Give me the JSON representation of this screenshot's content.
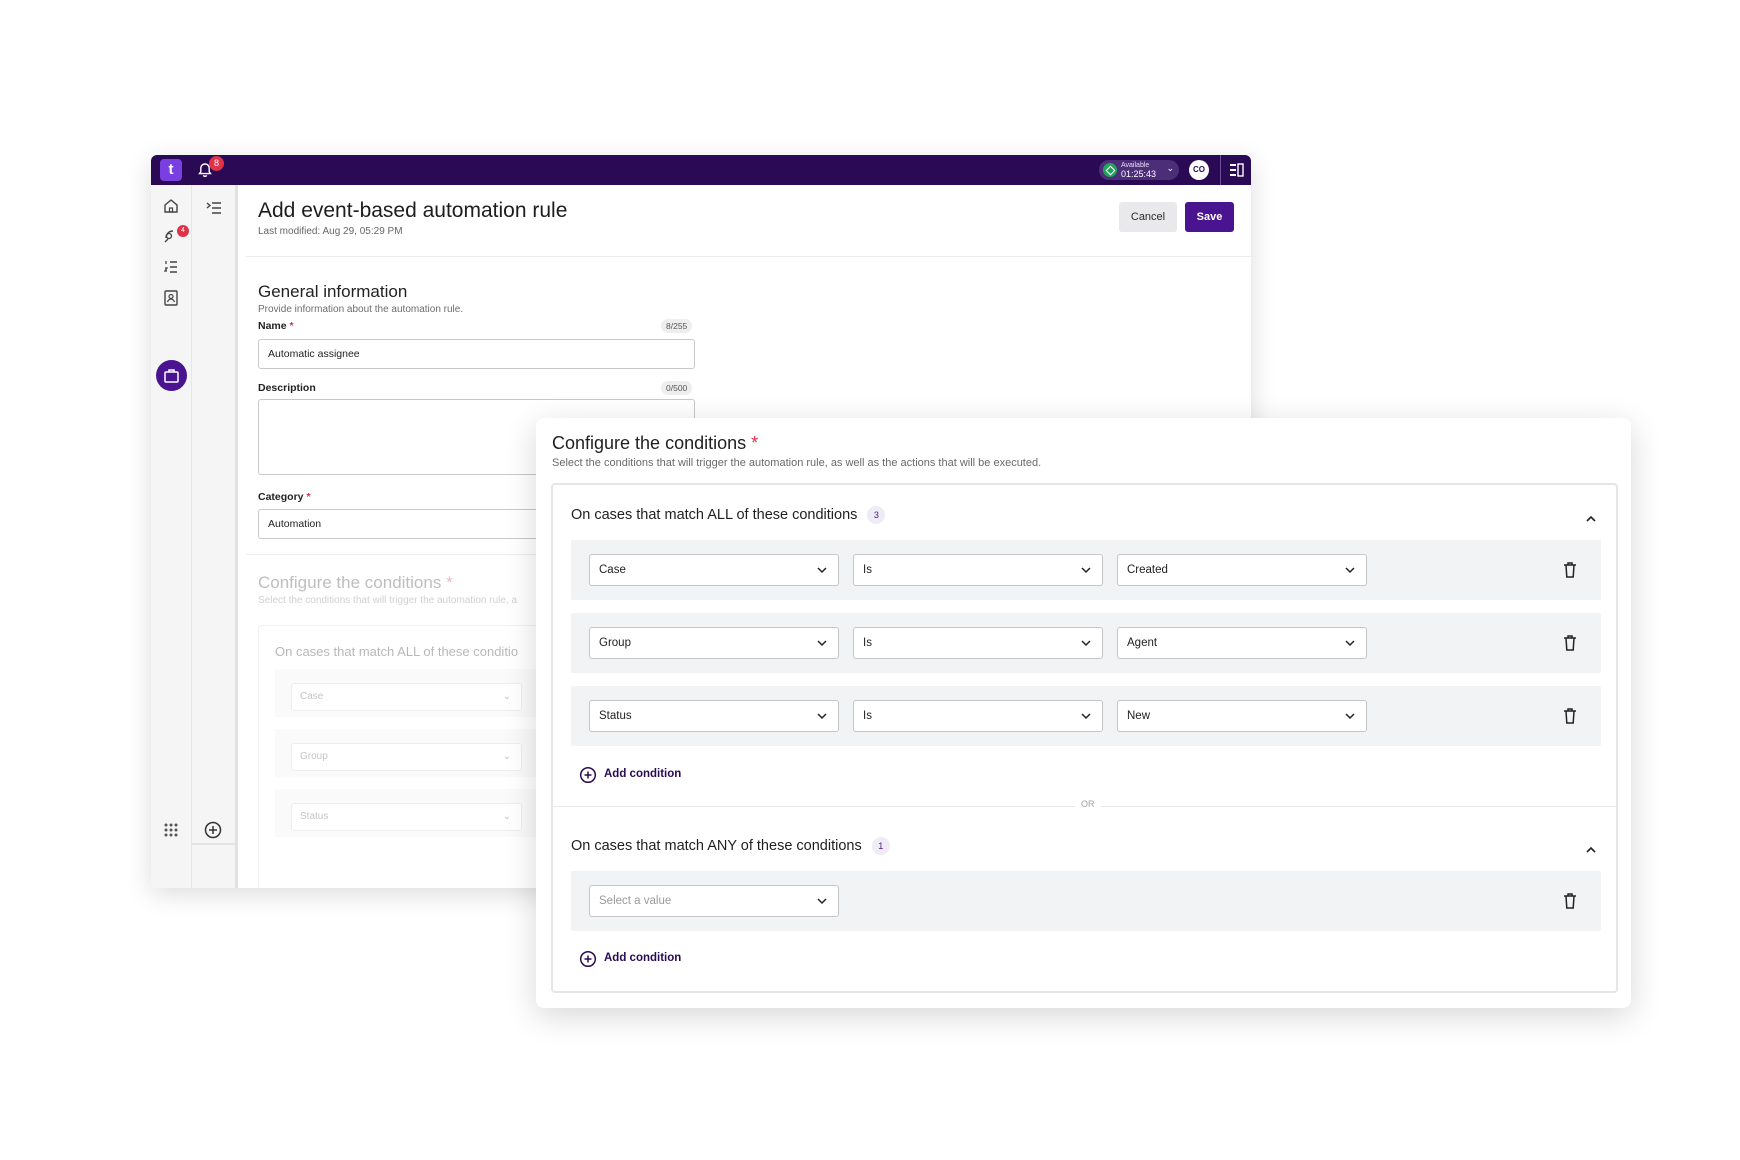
{
  "app": {
    "logo_glyph": "t",
    "notification_count": "8",
    "status": {
      "label": "Available",
      "time": "01:25:43",
      "color": "#1fa55a"
    },
    "avatar_initials": "CO",
    "rail_badge": "4",
    "brand_color": "#4a1491",
    "topbar_color": "#2a0a55"
  },
  "header": {
    "title": "Add event-based automation rule",
    "last_modified": "Last modified: Aug 29, 05:29 PM",
    "cancel_label": "Cancel",
    "save_label": "Save"
  },
  "general": {
    "title": "General information",
    "subtitle": "Provide information about the automation rule.",
    "name_label": "Name",
    "name_counter": "8/255",
    "name_value": "Automatic assignee",
    "description_label": "Description",
    "description_counter": "0/500",
    "category_label": "Category",
    "category_value": "Automation",
    "required_mark": "*"
  },
  "background_conditions": {
    "title": "Configure the conditions",
    "subtitle": "Select the conditions that will trigger the automation rule, a",
    "group_title": "On cases that match ALL of these conditio",
    "rows": [
      "Case",
      "Group",
      "Status"
    ]
  },
  "conditions": {
    "title": "Configure the conditions",
    "required_mark": "*",
    "subtitle": "Select the conditions that will trigger the automation rule, as well as the actions that will be executed.",
    "all_group": {
      "title": "On cases that match ALL of these conditions",
      "count": "3",
      "rows": [
        {
          "field": "Case",
          "operator": "Is",
          "value": "Created"
        },
        {
          "field": "Group",
          "operator": "Is",
          "value": "Agent"
        },
        {
          "field": "Status",
          "operator": "Is",
          "value": "New"
        }
      ],
      "add_label": "Add condition"
    },
    "or_label": "OR",
    "any_group": {
      "title": "On cases that match ANY of these conditions",
      "count": "1",
      "rows": [
        {
          "placeholder": "Select a value"
        }
      ],
      "add_label": "Add condition"
    }
  }
}
